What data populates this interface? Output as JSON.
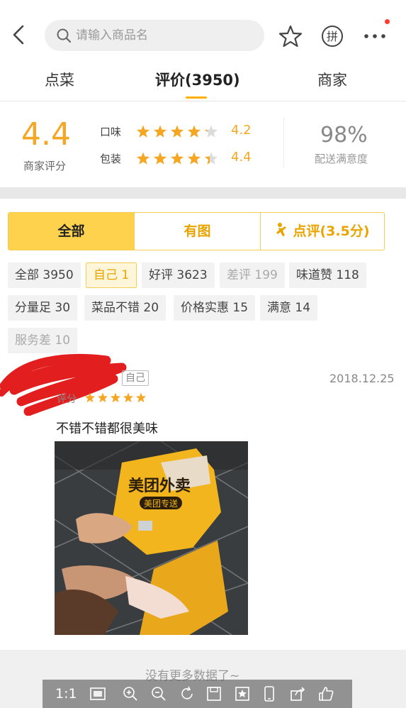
{
  "nav": {
    "search_placeholder": "请输入商品名",
    "pin_icon_text": "拼"
  },
  "tabs": [
    {
      "label": "点菜"
    },
    {
      "label": "评价(3950)",
      "active": true
    },
    {
      "label": "商家"
    }
  ],
  "score": {
    "overall": "4.4",
    "overall_label": "商家评分",
    "rows": [
      {
        "label": "口味",
        "value": "4.2",
        "stars": 4.2
      },
      {
        "label": "包装",
        "value": "4.4",
        "stars": 4.4
      }
    ],
    "delivery_pct": "98%",
    "delivery_label": "配送满意度"
  },
  "filter": {
    "segments": [
      {
        "label": "全部",
        "active": true
      },
      {
        "label": "有图"
      },
      {
        "label": "点评(3.5分)",
        "icon": "runner-icon"
      }
    ],
    "tags": [
      {
        "label": "全部 3950"
      },
      {
        "label": "自己 1",
        "selected": true
      },
      {
        "label": "好评 3623"
      },
      {
        "label": "差评 199",
        "dim": true
      },
      {
        "label": "味道赞 118"
      },
      {
        "label": "分量足 30"
      },
      {
        "label": "菜品不错 20"
      },
      {
        "label": "价格实惠 15"
      },
      {
        "label": "满意 14"
      },
      {
        "label": "服务差 10",
        "dim": true
      }
    ]
  },
  "review": {
    "badge": "自己",
    "date": "2018.12.25",
    "score_label": "评分",
    "stars": 5,
    "text": "不错不错都很美味",
    "photo_caption_brand": "美团外卖",
    "photo_caption_sub": "美团专送"
  },
  "footer": {
    "no_more": "没有更多数据了~"
  },
  "viewer": {
    "ratio_label": "1:1",
    "tools": [
      "fit-screen-icon",
      "zoom-in-icon",
      "zoom-out-icon",
      "rotate-icon",
      "save-icon",
      "bookmark-icon",
      "phone-icon",
      "share-icon",
      "like-icon"
    ]
  },
  "colors": {
    "accent": "#ffd24e",
    "accent_text": "#e9a400",
    "star": "#f5a623",
    "badge_red": "#ff3b30",
    "scribble": "#e31e1e"
  }
}
